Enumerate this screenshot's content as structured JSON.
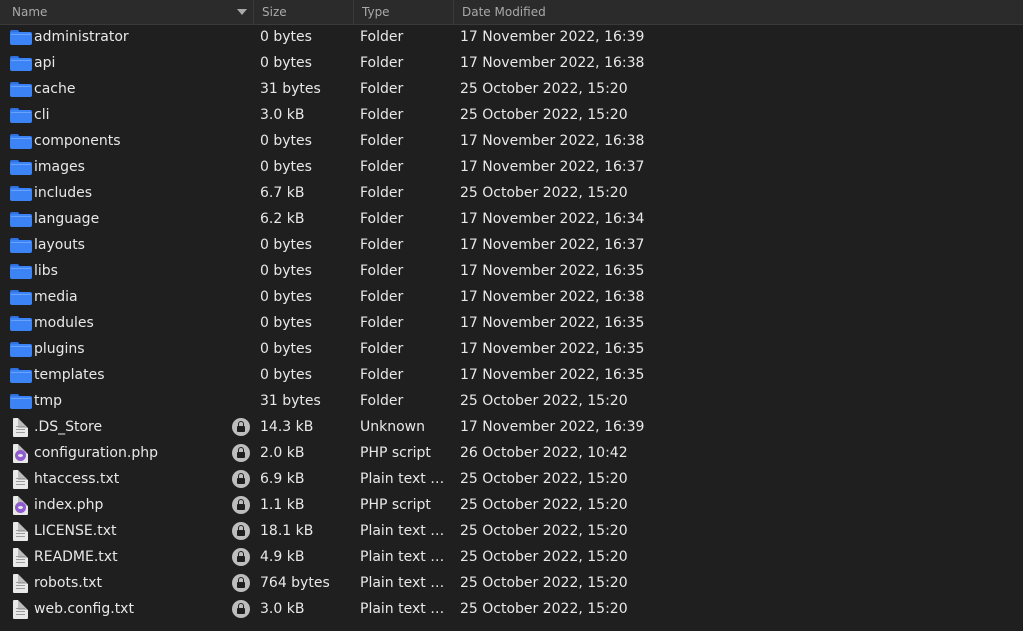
{
  "columns": {
    "name": "Name",
    "size": "Size",
    "type": "Type",
    "date": "Date Modified"
  },
  "rows": [
    {
      "name": "administrator",
      "size": "0 bytes",
      "type": "Folder",
      "date": "17 November 2022, 16:39",
      "icon": "folder-icon",
      "locked": false
    },
    {
      "name": "api",
      "size": "0 bytes",
      "type": "Folder",
      "date": "17 November 2022, 16:38",
      "icon": "folder-icon",
      "locked": false
    },
    {
      "name": "cache",
      "size": "31 bytes",
      "type": "Folder",
      "date": "25 October 2022, 15:20",
      "icon": "folder-icon",
      "locked": false
    },
    {
      "name": "cli",
      "size": "3.0 kB",
      "type": "Folder",
      "date": "25 October 2022, 15:20",
      "icon": "folder-icon",
      "locked": false
    },
    {
      "name": "components",
      "size": "0 bytes",
      "type": "Folder",
      "date": "17 November 2022, 16:38",
      "icon": "folder-icon",
      "locked": false
    },
    {
      "name": "images",
      "size": "0 bytes",
      "type": "Folder",
      "date": "17 November 2022, 16:37",
      "icon": "folder-icon",
      "locked": false
    },
    {
      "name": "includes",
      "size": "6.7 kB",
      "type": "Folder",
      "date": "25 October 2022, 15:20",
      "icon": "folder-icon",
      "locked": false
    },
    {
      "name": "language",
      "size": "6.2 kB",
      "type": "Folder",
      "date": "17 November 2022, 16:34",
      "icon": "folder-icon",
      "locked": false
    },
    {
      "name": "layouts",
      "size": "0 bytes",
      "type": "Folder",
      "date": "17 November 2022, 16:37",
      "icon": "folder-icon",
      "locked": false
    },
    {
      "name": "libs",
      "size": "0 bytes",
      "type": "Folder",
      "date": "17 November 2022, 16:35",
      "icon": "folder-icon",
      "locked": false
    },
    {
      "name": "media",
      "size": "0 bytes",
      "type": "Folder",
      "date": "17 November 2022, 16:38",
      "icon": "folder-icon",
      "locked": false
    },
    {
      "name": "modules",
      "size": "0 bytes",
      "type": "Folder",
      "date": "17 November 2022, 16:35",
      "icon": "folder-icon",
      "locked": false
    },
    {
      "name": "plugins",
      "size": "0 bytes",
      "type": "Folder",
      "date": "17 November 2022, 16:35",
      "icon": "folder-icon",
      "locked": false
    },
    {
      "name": "templates",
      "size": "0 bytes",
      "type": "Folder",
      "date": "17 November 2022, 16:35",
      "icon": "folder-icon",
      "locked": false
    },
    {
      "name": "tmp",
      "size": "31 bytes",
      "type": "Folder",
      "date": "25 October 2022, 15:20",
      "icon": "folder-icon",
      "locked": false
    },
    {
      "name": ".DS_Store",
      "size": "14.3 kB",
      "type": "Unknown",
      "date": "17 November 2022, 16:39",
      "icon": "file-icon",
      "locked": true
    },
    {
      "name": "configuration.php",
      "size": "2.0 kB",
      "type": "PHP script",
      "date": "26 October 2022, 10:42",
      "icon": "php-file-icon",
      "locked": true
    },
    {
      "name": "htaccess.txt",
      "size": "6.9 kB",
      "type": "Plain text d…",
      "date": "25 October 2022, 15:20",
      "icon": "text-file-icon",
      "locked": true
    },
    {
      "name": "index.php",
      "size": "1.1 kB",
      "type": "PHP script",
      "date": "25 October 2022, 15:20",
      "icon": "php-file-icon",
      "locked": true
    },
    {
      "name": "LICENSE.txt",
      "size": "18.1 kB",
      "type": "Plain text d…",
      "date": "25 October 2022, 15:20",
      "icon": "text-file-icon",
      "locked": true
    },
    {
      "name": "README.txt",
      "size": "4.9 kB",
      "type": "Plain text d…",
      "date": "25 October 2022, 15:20",
      "icon": "text-file-icon",
      "locked": true
    },
    {
      "name": "robots.txt",
      "size": "764 bytes",
      "type": "Plain text d…",
      "date": "25 October 2022, 15:20",
      "icon": "text-file-icon",
      "locked": true
    },
    {
      "name": "web.config.txt",
      "size": "3.0 kB",
      "type": "Plain text d…",
      "date": "25 October 2022, 15:20",
      "icon": "text-file-icon",
      "locked": true
    }
  ],
  "colors": {
    "background": "#1f1f1f",
    "header": "#2b2b2b",
    "folder": "#3c83f6",
    "php_badge": "#8e5ccf"
  }
}
